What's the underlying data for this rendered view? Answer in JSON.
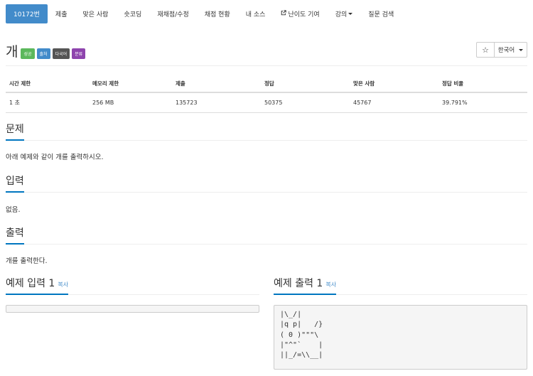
{
  "nav": {
    "items": [
      "10172번",
      "제출",
      "맞은 사람",
      "숏코딩",
      "재채점/수정",
      "채점 현황",
      "내 소스",
      "난이도 기여",
      "강의",
      "질문 검색"
    ]
  },
  "problem": {
    "title": "개",
    "labels": [
      "성공",
      "출처",
      "다국어",
      "분류"
    ],
    "star_icon": "☆",
    "language": "한국어"
  },
  "info": {
    "headers": [
      "시간 제한",
      "메모리 제한",
      "제출",
      "정답",
      "맞은 사람",
      "정답 비율"
    ],
    "values": [
      "1 초",
      "256 MB",
      "135723",
      "50375",
      "45767",
      "39.791%"
    ]
  },
  "sections": {
    "problem_head": "문제",
    "problem_text": "아래 예제와 같이 개를 출력하시오.",
    "input_head": "입력",
    "input_text": "없음.",
    "output_head": "출력",
    "output_text": "개를 출력한다."
  },
  "samples": {
    "input_head": "예제 입력 1",
    "output_head": "예제 출력 1",
    "copy_label": "복사",
    "input_value": "",
    "output_value": "|\\_/|\n|q p|   /}\n( 0 )\"\"\"\\\n|\"^\"`    |\n||_/=\\\\__|"
  },
  "colors": {
    "accent": "#428bca",
    "heading_underline": "#0076c0",
    "label_success": "#5cb85c",
    "label_source": "#428bca",
    "label_multilang": "#555555",
    "label_category": "#8e44ad"
  }
}
